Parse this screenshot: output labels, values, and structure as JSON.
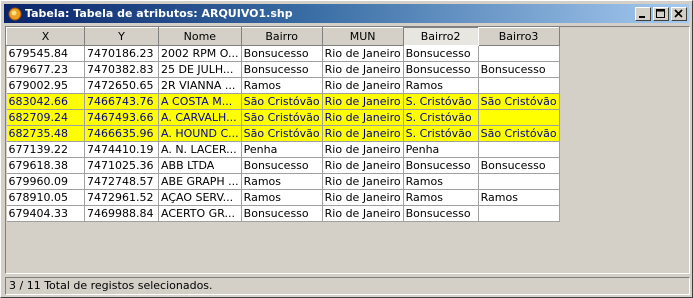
{
  "window": {
    "title": "Tabela: Tabela de atributos: ARQUIVO1.shp",
    "icon": "qgis-app-icon",
    "buttons": [
      "minimize",
      "maximize",
      "close"
    ]
  },
  "table": {
    "columns": [
      "X",
      "Y",
      "Nome",
      "Bairro",
      "MUN",
      "Bairro2",
      "Bairro3"
    ],
    "sorted_column": "Bairro2",
    "rows": [
      {
        "selected": false,
        "cells": [
          "679545.84",
          "7470186.23",
          "2002 RPM O...",
          "Bonsucesso",
          "Rio de Janeiro",
          "Bonsucesso",
          ""
        ]
      },
      {
        "selected": false,
        "cells": [
          "679677.23",
          "7470382.83",
          "25 DE JULH...",
          "Bonsucesso",
          "Rio de Janeiro",
          "Bonsucesso",
          "Bonsucesso"
        ]
      },
      {
        "selected": false,
        "cells": [
          "679002.95",
          "7472650.65",
          "2R VIANNA ...",
          "Ramos",
          "Rio de Janeiro",
          "Ramos",
          ""
        ]
      },
      {
        "selected": true,
        "cells": [
          "683042.66",
          "7466743.76",
          "A COSTA M...",
          "São Cristóvão",
          "Rio de Janeiro",
          "S. Cristóvão",
          "São Cristóvão"
        ]
      },
      {
        "selected": true,
        "cells": [
          "682709.24",
          "7467493.66",
          "A. CARVALH...",
          "São Cristóvão",
          "Rio de Janeiro",
          "S. Cristóvão",
          ""
        ]
      },
      {
        "selected": true,
        "cells": [
          "682735.48",
          "7466635.96",
          "A. HOUND C...",
          "São Cristóvão",
          "Rio de Janeiro",
          "S. Cristóvão",
          "São Cristóvão"
        ]
      },
      {
        "selected": false,
        "cells": [
          "677139.22",
          "7474410.19",
          "A. N. LACER...",
          "Penha",
          "Rio de Janeiro",
          "Penha",
          ""
        ]
      },
      {
        "selected": false,
        "cells": [
          "679618.38",
          "7471025.36",
          "ABB LTDA",
          "Bonsucesso",
          "Rio de Janeiro",
          "Bonsucesso",
          "Bonsucesso"
        ]
      },
      {
        "selected": false,
        "cells": [
          "679960.09",
          "7472748.57",
          "ABE GRAPH ...",
          "Ramos",
          "Rio de Janeiro",
          "Ramos",
          ""
        ]
      },
      {
        "selected": false,
        "cells": [
          "678910.05",
          "7472961.52",
          "AÇAO SERV...",
          "Ramos",
          "Rio de Janeiro",
          "Ramos",
          "Ramos"
        ]
      },
      {
        "selected": false,
        "cells": [
          "679404.33",
          "7469988.84",
          "ACERTO GR...",
          "Bonsucesso",
          "Rio de Janeiro",
          "Bonsucesso",
          ""
        ]
      }
    ]
  },
  "status": {
    "text": "3 / 11 Total de registos selecionados."
  },
  "colors": {
    "selection_bg": "#ffff00",
    "selection_fg": "#0000a0",
    "titlebar_start": "#0a246a",
    "titlebar_end": "#a6caf0"
  }
}
